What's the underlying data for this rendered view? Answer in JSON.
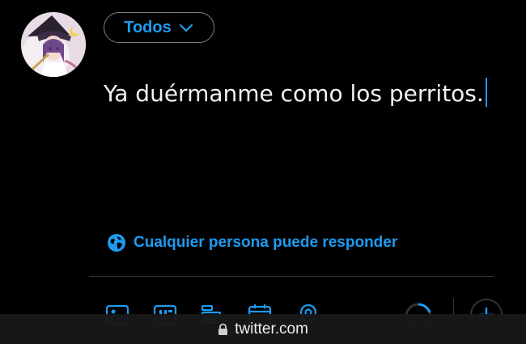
{
  "composer": {
    "audience_label": "Todos",
    "text": "Ya duérmanme como los perritos.",
    "reply_setting_label": "Cualquier persona puede responder"
  },
  "toolbar": {
    "icons": [
      "image-icon",
      "gif-icon",
      "poll-icon",
      "schedule-icon",
      "location-icon"
    ]
  },
  "browser": {
    "url": "twitter.com"
  },
  "colors": {
    "accent": "#1d9bf0",
    "background": "#000000",
    "text": "#f2f2f2",
    "border": "#2f3336"
  }
}
